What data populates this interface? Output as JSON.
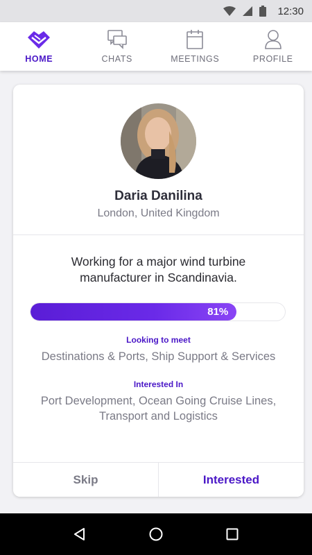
{
  "status_bar": {
    "time": "12:30",
    "icons": [
      "wifi-icon",
      "signal-icon",
      "battery-icon"
    ]
  },
  "nav": {
    "tabs": [
      {
        "label": "HOME",
        "icon": "handshake-icon",
        "active": true
      },
      {
        "label": "CHATS",
        "icon": "chat-bubbles-icon",
        "active": false
      },
      {
        "label": "MEETINGS",
        "icon": "calendar-icon",
        "active": false
      },
      {
        "label": "PROFILE",
        "icon": "user-icon",
        "active": false
      }
    ]
  },
  "profile": {
    "name": "Daria Danilina",
    "location": "London, United Kingdom",
    "bio": "Working for a major wind turbine manufacturer in Scandinavia.",
    "match_percent": 81,
    "match_label": "81%",
    "looking_to_meet_label": "Looking to meet",
    "looking_to_meet_value": "Destinations & Ports, Ship Support & Services",
    "interested_in_label": "Interested In",
    "interested_in_value": "Port Development, Ocean Going Cruise Lines, Transport and Logistics"
  },
  "actions": {
    "skip_label": "Skip",
    "interested_label": "Interested"
  },
  "colors": {
    "accent": "#4a17c7",
    "progress": "#5a1dd6",
    "muted_text": "#7a7a86"
  }
}
